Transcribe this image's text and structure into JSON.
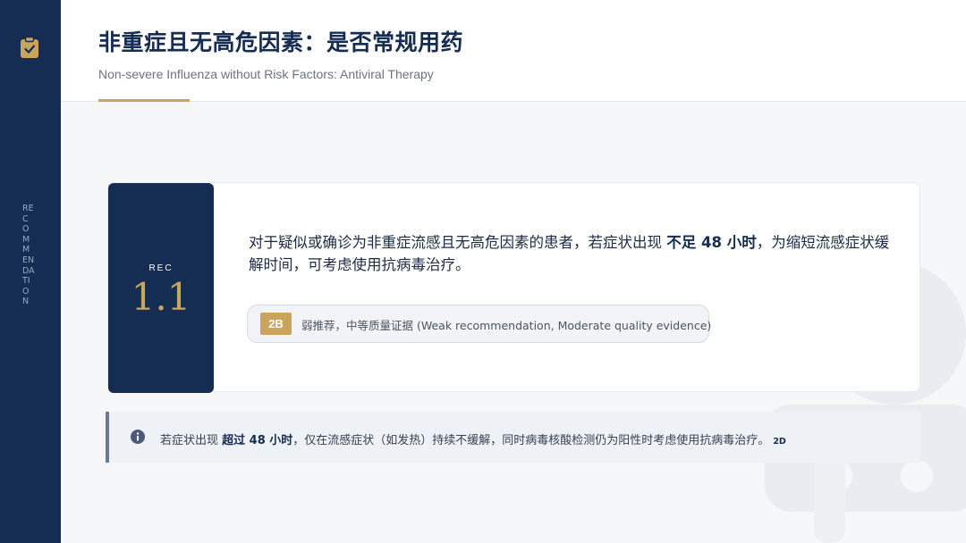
{
  "sidebar": {
    "vertical_text": "RECOMMENDATION",
    "icon": "clipboard-check-icon"
  },
  "header": {
    "title": "非重症且无高危因素：是否常规用药",
    "subtitle": "Non-severe Influenza without Risk Factors: Antiviral Therapy"
  },
  "recommendation": {
    "label": "REC",
    "number": "1.1",
    "text_before": "对于疑似或确诊为非重症流感且无高危因素的患者，若症状出现 ",
    "text_emphasis": "不足 48 小时",
    "text_after": "，为缩短流感症状缓解时间，可考虑使用抗病毒治疗。",
    "grade_code": "2B",
    "grade_text": "弱推荐，中等质量证据 (Weak recommendation, Moderate quality evidence)"
  },
  "note": {
    "icon": "info-icon",
    "text_before": "若症状出现 ",
    "text_emphasis": "超过 48 小时",
    "text_after": "，仅在流感症状（如发热）持续不缓解，同时病毒核酸检测仍为阳性时考虑使用抗病毒治疗。",
    "grade": "2D"
  },
  "colors": {
    "navy": "#152c53",
    "gold": "#c9a55c",
    "background": "#f6f7f9"
  }
}
